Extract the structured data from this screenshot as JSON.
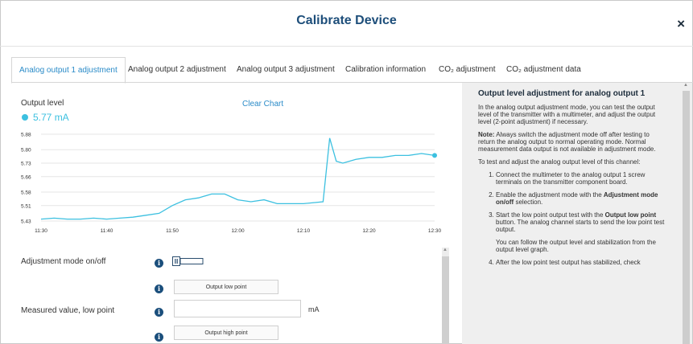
{
  "dialog": {
    "title": "Calibrate Device",
    "close_label": "×"
  },
  "tabs": [
    {
      "label": "Analog output 1 adjustment",
      "active": true
    },
    {
      "label": "Analog output 2 adjustment",
      "active": false
    },
    {
      "label": "Analog output 3 adjustment",
      "active": false
    },
    {
      "label": "Calibration information",
      "active": false
    },
    {
      "label": "CO₂ adjustment",
      "active": false
    },
    {
      "label": "CO₂ adjustment data",
      "active": false
    }
  ],
  "output": {
    "label": "Output level",
    "clear_label": "Clear Chart",
    "current_value": "5.77 mA",
    "series_color": "#3cc0e0"
  },
  "chart_data": {
    "type": "line",
    "y_ticks": [
      "5.88",
      "5.80",
      "5.73",
      "5.66",
      "5.58",
      "5.51",
      "5.43"
    ],
    "x_ticks": [
      "11:30",
      "11:40",
      "11:50",
      "12:00",
      "12:10",
      "12:20",
      "12:30"
    ],
    "ylim": [
      5.43,
      5.88
    ],
    "x": [
      "11:30",
      "11:32",
      "11:34",
      "11:36",
      "11:38",
      "11:40",
      "11:42",
      "11:44",
      "11:46",
      "11:48",
      "11:50",
      "11:52",
      "11:54",
      "11:56",
      "11:58",
      "12:00",
      "12:02",
      "12:04",
      "12:06",
      "12:08",
      "12:10",
      "12:13",
      "12:14",
      "12:15",
      "12:16",
      "12:18",
      "12:20",
      "12:22",
      "12:24",
      "12:26",
      "12:28",
      "12:30"
    ],
    "series": [
      {
        "values": [
          5.44,
          5.445,
          5.44,
          5.44,
          5.445,
          5.44,
          5.445,
          5.45,
          5.46,
          5.47,
          5.51,
          5.54,
          5.55,
          5.57,
          5.57,
          5.54,
          5.53,
          5.54,
          5.52,
          5.52,
          5.52,
          5.53,
          5.86,
          5.74,
          5.73,
          5.75,
          5.76,
          5.76,
          5.77,
          5.77,
          5.78,
          5.77
        ]
      }
    ]
  },
  "rows": {
    "adjustment_mode_label": "Adjustment mode on/off",
    "output_low_label": "Output low point",
    "measured_low_label": "Measured value, low point",
    "unit": "mA",
    "output_high_label": "Output high point",
    "info_glyph": "i",
    "toggle_state": "off"
  },
  "help": {
    "title": "Output level adjustment for analog output 1",
    "p1": "In the analog output adjustment mode, you can test the output level of the transmitter with a multimeter, and adjust the output level (2-point adjustment) if necessary.",
    "note_label": "Note:",
    "note_text": " Always switch the adjustment mode off after testing to return the analog output to normal operating mode. Normal measurement data output is not available in adjustment mode.",
    "p3": "To test and adjust the analog output level of this channel:",
    "s1": "Connect the multimeter to the analog output 1 screw terminals on the transmitter component board.",
    "s2a": "Enable the adjustment mode with the ",
    "s2b": "Adjustment mode on/off",
    "s2c": " selection.",
    "s3a": "Start the low point output test with the ",
    "s3b": "Output low point",
    "s3c": " button. The analog channel starts to send the low point test output.",
    "s3p": "You can follow the output level and stabilization from the output level graph.",
    "s4": "After the low point test output has stabilized, check"
  }
}
